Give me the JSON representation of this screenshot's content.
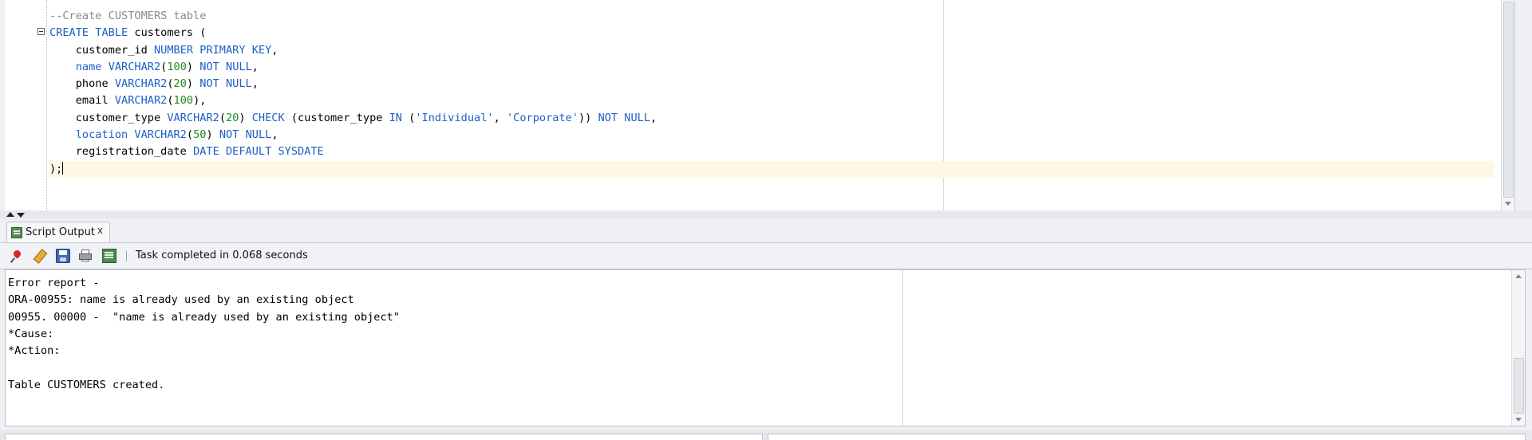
{
  "editor": {
    "lines": [
      {
        "seg": [
          {
            "t": "--Create CUSTOMERS table",
            "c": "cmt"
          }
        ]
      },
      {
        "seg": [
          {
            "t": "CREATE TABLE",
            "c": "kw"
          },
          {
            "t": " customers (",
            "c": ""
          }
        ]
      },
      {
        "seg": [
          {
            "t": "    customer_id ",
            "c": ""
          },
          {
            "t": "NUMBER PRIMARY KEY",
            "c": "kw"
          },
          {
            "t": ",",
            "c": ""
          }
        ]
      },
      {
        "seg": [
          {
            "t": "    ",
            "c": ""
          },
          {
            "t": "name",
            "c": "kw"
          },
          {
            "t": " ",
            "c": ""
          },
          {
            "t": "VARCHAR2",
            "c": "kw"
          },
          {
            "t": "(",
            "c": ""
          },
          {
            "t": "100",
            "c": "num"
          },
          {
            "t": ") ",
            "c": ""
          },
          {
            "t": "NOT NULL",
            "c": "kw"
          },
          {
            "t": ",",
            "c": ""
          }
        ]
      },
      {
        "seg": [
          {
            "t": "    phone ",
            "c": ""
          },
          {
            "t": "VARCHAR2",
            "c": "kw"
          },
          {
            "t": "(",
            "c": ""
          },
          {
            "t": "20",
            "c": "num"
          },
          {
            "t": ") ",
            "c": ""
          },
          {
            "t": "NOT NULL",
            "c": "kw"
          },
          {
            "t": ",",
            "c": ""
          }
        ]
      },
      {
        "seg": [
          {
            "t": "    email ",
            "c": ""
          },
          {
            "t": "VARCHAR2",
            "c": "kw"
          },
          {
            "t": "(",
            "c": ""
          },
          {
            "t": "100",
            "c": "num"
          },
          {
            "t": "),",
            "c": ""
          }
        ]
      },
      {
        "seg": [
          {
            "t": "    customer_type ",
            "c": ""
          },
          {
            "t": "VARCHAR2",
            "c": "kw"
          },
          {
            "t": "(",
            "c": ""
          },
          {
            "t": "20",
            "c": "num"
          },
          {
            "t": ") ",
            "c": ""
          },
          {
            "t": "CHECK",
            "c": "kw"
          },
          {
            "t": " (customer_type ",
            "c": ""
          },
          {
            "t": "IN",
            "c": "kw"
          },
          {
            "t": " (",
            "c": ""
          },
          {
            "t": "'Individual'",
            "c": "str"
          },
          {
            "t": ", ",
            "c": ""
          },
          {
            "t": "'Corporate'",
            "c": "str"
          },
          {
            "t": ")) ",
            "c": ""
          },
          {
            "t": "NOT NULL",
            "c": "kw"
          },
          {
            "t": ",",
            "c": ""
          }
        ]
      },
      {
        "seg": [
          {
            "t": "    ",
            "c": ""
          },
          {
            "t": "location",
            "c": "kw"
          },
          {
            "t": " ",
            "c": ""
          },
          {
            "t": "VARCHAR2",
            "c": "kw"
          },
          {
            "t": "(",
            "c": ""
          },
          {
            "t": "50",
            "c": "num"
          },
          {
            "t": ") ",
            "c": ""
          },
          {
            "t": "NOT NULL",
            "c": "kw"
          },
          {
            "t": ",",
            "c": ""
          }
        ]
      },
      {
        "seg": [
          {
            "t": "    registration_date ",
            "c": ""
          },
          {
            "t": "DATE DEFAULT SYSDATE",
            "c": "kw"
          }
        ]
      },
      {
        "seg": [
          {
            "t": ");",
            "c": ""
          }
        ],
        "current": true,
        "caret": true
      }
    ]
  },
  "output_panel": {
    "tab_label": "Script Output",
    "close_glyph": "x",
    "status": "Task completed in 0.068 seconds",
    "toolbar_icons": [
      "pin-icon",
      "eraser-icon",
      "save-icon",
      "print-icon",
      "run-icon"
    ],
    "lines": [
      "Error report -",
      "ORA-00955: name is already used by an existing object",
      "00955. 00000 -  \"name is already used by an existing object\"",
      "*Cause:",
      "*Action:",
      "",
      "Table CUSTOMERS created."
    ]
  },
  "colors": {
    "keyword": "#1e5fc6",
    "number": "#1f8a1f",
    "comment": "#8a8a8a",
    "current_line": "#fdf8e4"
  }
}
